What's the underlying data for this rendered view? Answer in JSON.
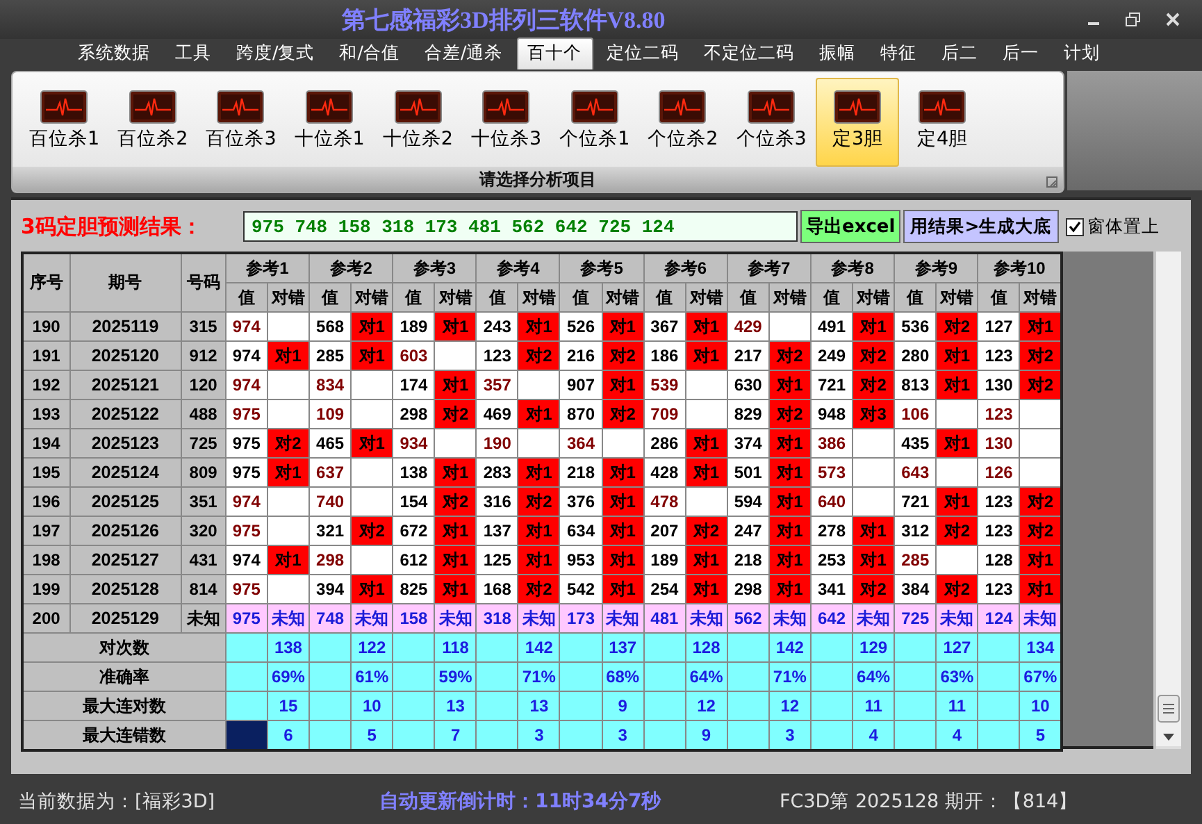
{
  "window": {
    "title": "第七感福彩3D排列三软件V8.80"
  },
  "menu": [
    {
      "label": "系统数据",
      "selected": false
    },
    {
      "label": "工具",
      "selected": false
    },
    {
      "label": "跨度/复式",
      "selected": false
    },
    {
      "label": "和/合值",
      "selected": false
    },
    {
      "label": "合差/通杀",
      "selected": false
    },
    {
      "label": "百十个",
      "selected": true
    },
    {
      "label": "定位二码",
      "selected": false
    },
    {
      "label": "不定位二码",
      "selected": false
    },
    {
      "label": "振幅",
      "selected": false
    },
    {
      "label": "特征",
      "selected": false
    },
    {
      "label": "后二",
      "selected": false
    },
    {
      "label": "后一",
      "selected": false
    },
    {
      "label": "计划",
      "selected": false
    }
  ],
  "ribbon": {
    "items": [
      {
        "label": "百位杀1",
        "selected": false
      },
      {
        "label": "百位杀2",
        "selected": false
      },
      {
        "label": "百位杀3",
        "selected": false
      },
      {
        "label": "十位杀1",
        "selected": false
      },
      {
        "label": "十位杀2",
        "selected": false
      },
      {
        "label": "十位杀3",
        "selected": false
      },
      {
        "label": "个位杀1",
        "selected": false
      },
      {
        "label": "个位杀2",
        "selected": false
      },
      {
        "label": "个位杀3",
        "selected": false
      },
      {
        "label": "定3胆",
        "selected": true
      },
      {
        "label": "定4胆",
        "selected": false
      }
    ],
    "caption": "请选择分析项目"
  },
  "prediction": {
    "label": "3码定胆预测结果：",
    "value": "975 748 158 318 173 481 562 642 725 124",
    "buttons": [
      "导出excel",
      "用结果>生成大底"
    ],
    "checkbox": {
      "label": "窗体置上",
      "checked": true
    }
  },
  "table": {
    "columns": [
      "序号",
      "期号",
      "号码"
    ],
    "groups": [
      {
        "label": "参考1",
        "sub_columns": [
          "值",
          "对错"
        ]
      },
      {
        "label": "参考2",
        "sub_columns": [
          "值",
          "对错"
        ]
      },
      {
        "label": "参考3",
        "sub_columns": [
          "值",
          "对错"
        ]
      },
      {
        "label": "参考4",
        "sub_columns": [
          "值",
          "对错"
        ]
      },
      {
        "label": "参考5",
        "sub_columns": [
          "值",
          "对错"
        ]
      },
      {
        "label": "参考6",
        "sub_columns": [
          "值",
          "对错"
        ]
      },
      {
        "label": "参考7",
        "sub_columns": [
          "值",
          "对错"
        ]
      },
      {
        "label": "参考8",
        "sub_columns": [
          "值",
          "对错"
        ]
      },
      {
        "label": "参考9",
        "sub_columns": [
          "值",
          "对错"
        ]
      },
      {
        "label": "参考10",
        "sub_columns": [
          "值",
          "对错"
        ]
      }
    ],
    "rows": [
      {
        "kind": "history",
        "seq": "190",
        "issue": "2025119",
        "number": "315",
        "cells": [
          {
            "value": "974"
          },
          {
            "value": "568",
            "result": "对1"
          },
          {
            "value": "189",
            "result": "对1"
          },
          {
            "value": "243",
            "result": "对1"
          },
          {
            "value": "526",
            "result": "对1"
          },
          {
            "value": "367",
            "result": "对1"
          },
          {
            "value": "429"
          },
          {
            "value": "491",
            "result": "对1"
          },
          {
            "value": "536",
            "result": "对2"
          },
          {
            "value": "127",
            "result": "对1"
          }
        ]
      },
      {
        "kind": "history",
        "seq": "191",
        "issue": "2025120",
        "number": "912",
        "cells": [
          {
            "value": "974",
            "result": "对1"
          },
          {
            "value": "285",
            "result": "对1"
          },
          {
            "value": "603"
          },
          {
            "value": "123",
            "result": "对2"
          },
          {
            "value": "216",
            "result": "对2"
          },
          {
            "value": "186",
            "result": "对1"
          },
          {
            "value": "217",
            "result": "对2"
          },
          {
            "value": "249",
            "result": "对2"
          },
          {
            "value": "280",
            "result": "对1"
          },
          {
            "value": "123",
            "result": "对2"
          }
        ]
      },
      {
        "kind": "history",
        "seq": "192",
        "issue": "2025121",
        "number": "120",
        "cells": [
          {
            "value": "974"
          },
          {
            "value": "834"
          },
          {
            "value": "174",
            "result": "对1"
          },
          {
            "value": "357"
          },
          {
            "value": "907",
            "result": "对1"
          },
          {
            "value": "539"
          },
          {
            "value": "630",
            "result": "对1"
          },
          {
            "value": "721",
            "result": "对2"
          },
          {
            "value": "813",
            "result": "对1"
          },
          {
            "value": "130",
            "result": "对2"
          }
        ]
      },
      {
        "kind": "history",
        "seq": "193",
        "issue": "2025122",
        "number": "488",
        "cells": [
          {
            "value": "975"
          },
          {
            "value": "109"
          },
          {
            "value": "298",
            "result": "对2"
          },
          {
            "value": "469",
            "result": "对1"
          },
          {
            "value": "870",
            "result": "对2"
          },
          {
            "value": "709"
          },
          {
            "value": "829",
            "result": "对2"
          },
          {
            "value": "948",
            "result": "对3"
          },
          {
            "value": "106"
          },
          {
            "value": "123"
          }
        ]
      },
      {
        "kind": "history",
        "seq": "194",
        "issue": "2025123",
        "number": "725",
        "cells": [
          {
            "value": "975",
            "result": "对2"
          },
          {
            "value": "465",
            "result": "对1"
          },
          {
            "value": "934"
          },
          {
            "value": "190"
          },
          {
            "value": "364"
          },
          {
            "value": "286",
            "result": "对1"
          },
          {
            "value": "374",
            "result": "对1"
          },
          {
            "value": "386"
          },
          {
            "value": "435",
            "result": "对1"
          },
          {
            "value": "130"
          }
        ]
      },
      {
        "kind": "history",
        "seq": "195",
        "issue": "2025124",
        "number": "809",
        "cells": [
          {
            "value": "975",
            "result": "对1"
          },
          {
            "value": "637"
          },
          {
            "value": "138",
            "result": "对1"
          },
          {
            "value": "283",
            "result": "对1"
          },
          {
            "value": "218",
            "result": "对1"
          },
          {
            "value": "428",
            "result": "对1"
          },
          {
            "value": "501",
            "result": "对1"
          },
          {
            "value": "573"
          },
          {
            "value": "643"
          },
          {
            "value": "126"
          }
        ]
      },
      {
        "kind": "history",
        "seq": "196",
        "issue": "2025125",
        "number": "351",
        "cells": [
          {
            "value": "974"
          },
          {
            "value": "740"
          },
          {
            "value": "154",
            "result": "对2"
          },
          {
            "value": "316",
            "result": "对2"
          },
          {
            "value": "376",
            "result": "对1"
          },
          {
            "value": "478"
          },
          {
            "value": "594",
            "result": "对1"
          },
          {
            "value": "640"
          },
          {
            "value": "721",
            "result": "对1"
          },
          {
            "value": "123",
            "result": "对2"
          }
        ]
      },
      {
        "kind": "history",
        "seq": "197",
        "issue": "2025126",
        "number": "320",
        "cells": [
          {
            "value": "975"
          },
          {
            "value": "321",
            "result": "对2"
          },
          {
            "value": "672",
            "result": "对1"
          },
          {
            "value": "137",
            "result": "对1"
          },
          {
            "value": "634",
            "result": "对1"
          },
          {
            "value": "207",
            "result": "对2"
          },
          {
            "value": "247",
            "result": "对1"
          },
          {
            "value": "278",
            "result": "对1"
          },
          {
            "value": "312",
            "result": "对2"
          },
          {
            "value": "123",
            "result": "对2"
          }
        ]
      },
      {
        "kind": "history",
        "seq": "198",
        "issue": "2025127",
        "number": "431",
        "cells": [
          {
            "value": "974",
            "result": "对1"
          },
          {
            "value": "298"
          },
          {
            "value": "612",
            "result": "对1"
          },
          {
            "value": "125",
            "result": "对1"
          },
          {
            "value": "953",
            "result": "对1"
          },
          {
            "value": "189",
            "result": "对1"
          },
          {
            "value": "218",
            "result": "对1"
          },
          {
            "value": "253",
            "result": "对1"
          },
          {
            "value": "285"
          },
          {
            "value": "128",
            "result": "对1"
          }
        ]
      },
      {
        "kind": "history",
        "seq": "199",
        "issue": "2025128",
        "number": "814",
        "cells": [
          {
            "value": "975"
          },
          {
            "value": "394",
            "result": "对1"
          },
          {
            "value": "825",
            "result": "对1"
          },
          {
            "value": "168",
            "result": "对2"
          },
          {
            "value": "542",
            "result": "对1"
          },
          {
            "value": "254",
            "result": "对1"
          },
          {
            "value": "298",
            "result": "对1"
          },
          {
            "value": "341",
            "result": "对2"
          },
          {
            "value": "384",
            "result": "对2"
          },
          {
            "value": "123",
            "result": "对1"
          }
        ]
      },
      {
        "kind": "pending",
        "seq": "200",
        "issue": "2025129",
        "number": "未知",
        "cells": [
          {
            "value": "975",
            "result": "未知"
          },
          {
            "value": "748",
            "result": "未知"
          },
          {
            "value": "158",
            "result": "未知"
          },
          {
            "value": "318",
            "result": "未知"
          },
          {
            "value": "173",
            "result": "未知"
          },
          {
            "value": "481",
            "result": "未知"
          },
          {
            "value": "562",
            "result": "未知"
          },
          {
            "value": "642",
            "result": "未知"
          },
          {
            "value": "725",
            "result": "未知"
          },
          {
            "value": "124",
            "result": "未知"
          }
        ]
      }
    ],
    "stats": [
      {
        "label": "对次数",
        "focused": false,
        "values": [
          "138",
          "122",
          "118",
          "142",
          "137",
          "128",
          "142",
          "129",
          "127",
          "134"
        ]
      },
      {
        "label": "准确率",
        "focused": false,
        "values": [
          "69%",
          "61%",
          "59%",
          "71%",
          "68%",
          "64%",
          "71%",
          "64%",
          "63%",
          "67%"
        ]
      },
      {
        "label": "最大连对数",
        "focused": false,
        "values": [
          "15",
          "10",
          "13",
          "13",
          "9",
          "12",
          "12",
          "11",
          "11",
          "10"
        ]
      },
      {
        "label": "最大连错数",
        "focused": true,
        "values": [
          "6",
          "5",
          "7",
          "3",
          "3",
          "9",
          "3",
          "4",
          "4",
          "5"
        ]
      }
    ]
  },
  "status_bar": {
    "source": "当前数据为：[福彩3D]",
    "countdown_label": "自动更新倒计时：",
    "countdown": "11时34分7秒",
    "latest": "FC3D第 2025128 期开：【814】"
  }
}
